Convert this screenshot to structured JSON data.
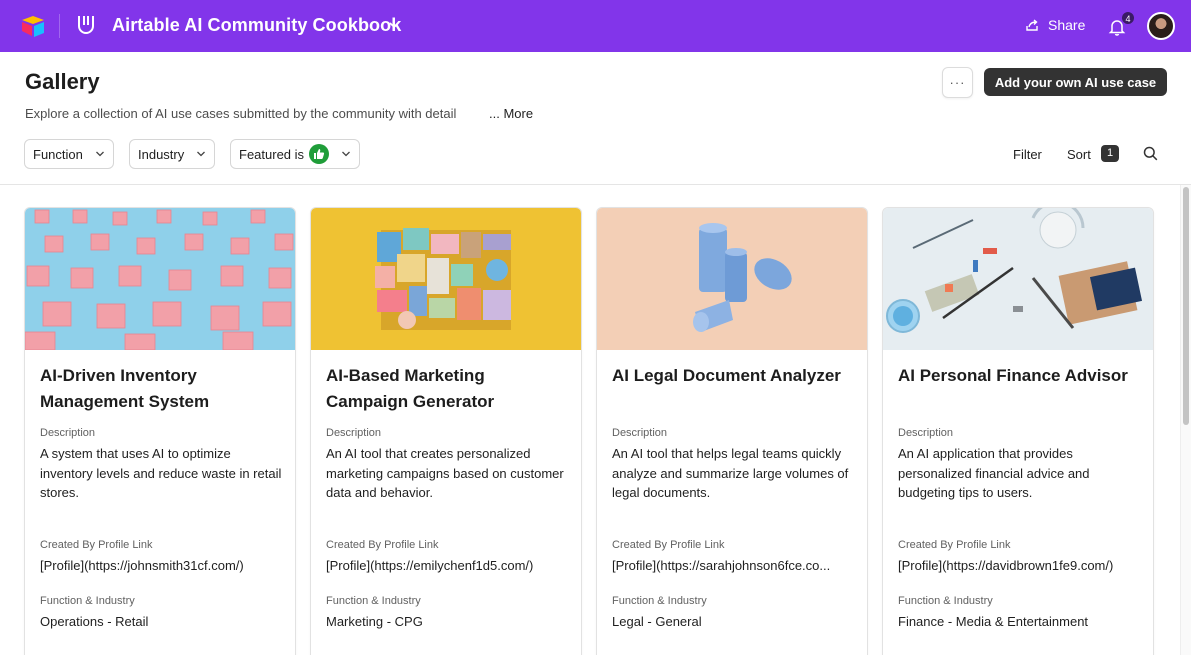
{
  "topbar": {
    "base_title": "Airtable AI Community Cookbook",
    "share_label": "Share",
    "notification_count": "4",
    "accent_color": "#8235ea"
  },
  "header": {
    "page_title": "Gallery",
    "more_button_label": "···",
    "add_button_label": "Add your own AI use case",
    "description": "Explore a collection of AI use cases submitted by the community with detail",
    "description_more": "... More"
  },
  "filters": {
    "function_label": "Function",
    "industry_label": "Industry",
    "featured_label": "Featured is",
    "filter_label": "Filter",
    "sort_label": "Sort",
    "sort_count": "1"
  },
  "cards": [
    {
      "title": "AI-Driven Inventory Management System",
      "description_label": "Description",
      "description": "A system that uses AI to optimize inventory levels and reduce waste in retail stores.",
      "created_by_label": "Created By Profile Link",
      "created_by": "[Profile](https://johnsmith31cf.com/)",
      "function_label": "Function & Industry",
      "function": "Operations - Retail"
    },
    {
      "title": "AI-Based Marketing Campaign Generator",
      "description_label": "Description",
      "description": "An AI tool that creates personalized marketing campaigns based on customer data and behavior.",
      "created_by_label": "Created By Profile Link",
      "created_by": "[Profile](https://emilychenf1d5.com/)",
      "function_label": "Function & Industry",
      "function": "Marketing - CPG"
    },
    {
      "title": "AI Legal Document Analyzer",
      "description_label": "Description",
      "description": "An AI tool that helps legal teams quickly analyze and summarize large volumes of legal documents.",
      "created_by_label": "Created By Profile Link",
      "created_by": "[Profile](https://sarahjohnson6fce.co...",
      "function_label": "Function & Industry",
      "function": "Legal - General"
    },
    {
      "title": "AI Personal Finance Advisor",
      "description_label": "Description",
      "description": "An AI application that provides personalized financial advice and budgeting tips to users.",
      "created_by_label": "Created By Profile Link",
      "created_by": "[Profile](https://davidbrown1fe9.com/)",
      "function_label": "Function & Industry",
      "function": "Finance - Media & Entertainment"
    }
  ]
}
